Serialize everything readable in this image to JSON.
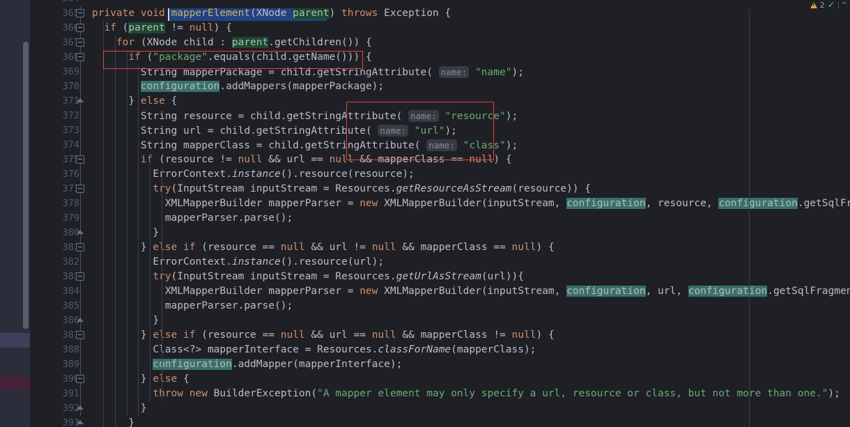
{
  "editor": {
    "language": "java",
    "theme_background": "#1e2025",
    "gutter_background": "#1e2025",
    "annotation_strip_background": "#2b2d3a",
    "selection_color": "#214283",
    "usage_highlight_color": "#1b4a2c",
    "identifier_highlight_color": "#3a7068",
    "annotation_box_color": "#e8453c",
    "first_visible_line": 364,
    "last_visible_line": 393
  },
  "status": {
    "warning_icon": "warning-triangle-icon",
    "warning_count": "2",
    "inspection_icon": "green-check-icon",
    "collapse_icon": "chevron-up-icon"
  },
  "line_numbers": [
    "364",
    "365",
    "366",
    "367",
    "368",
    "369",
    "370",
    "371",
    "372",
    "373",
    "374",
    "375",
    "376",
    "377",
    "378",
    "379",
    "380",
    "381",
    "382",
    "383",
    "384",
    "385",
    "386",
    "387",
    "388",
    "389",
    "390",
    "391",
    "392",
    "393"
  ],
  "code_lines": [
    {
      "n": "364",
      "text": ""
    },
    {
      "n": "365",
      "text": "private void mapperElement(XNode parent) throws Exception {"
    },
    {
      "n": "366",
      "text": "  if (parent != null) {"
    },
    {
      "n": "367",
      "text": "    for (XNode child : parent.getChildren()) {"
    },
    {
      "n": "368",
      "text": "      if (\"package\".equals(child.getName())) {"
    },
    {
      "n": "369",
      "text": "        String mapperPackage = child.getStringAttribute( name: \"name\");"
    },
    {
      "n": "370",
      "text": "        configuration.addMappers(mapperPackage);"
    },
    {
      "n": "371",
      "text": "      } else {"
    },
    {
      "n": "372",
      "text": "        String resource = child.getStringAttribute( name: \"resource\");"
    },
    {
      "n": "373",
      "text": "        String url = child.getStringAttribute( name: \"url\");"
    },
    {
      "n": "374",
      "text": "        String mapperClass = child.getStringAttribute( name: \"class\");"
    },
    {
      "n": "375",
      "text": "        if (resource != null && url == null && mapperClass == null) {"
    },
    {
      "n": "376",
      "text": "          ErrorContext.instance().resource(resource);"
    },
    {
      "n": "377",
      "text": "          try(InputStream inputStream = Resources.getResourceAsStream(resource)) {"
    },
    {
      "n": "378",
      "text": "            XMLMapperBuilder mapperParser = new XMLMapperBuilder(inputStream, configuration, resource, configuration.getSqlFragments());"
    },
    {
      "n": "379",
      "text": "            mapperParser.parse();"
    },
    {
      "n": "380",
      "text": "          }"
    },
    {
      "n": "381",
      "text": "        } else if (resource == null && url != null && mapperClass == null) {"
    },
    {
      "n": "382",
      "text": "          ErrorContext.instance().resource(url);"
    },
    {
      "n": "383",
      "text": "          try(InputStream inputStream = Resources.getUrlAsStream(url)){"
    },
    {
      "n": "384",
      "text": "            XMLMapperBuilder mapperParser = new XMLMapperBuilder(inputStream, configuration, url, configuration.getSqlFragments());"
    },
    {
      "n": "385",
      "text": "            mapperParser.parse();"
    },
    {
      "n": "386",
      "text": "          }"
    },
    {
      "n": "387",
      "text": "        } else if (resource == null && url == null && mapperClass != null) {"
    },
    {
      "n": "388",
      "text": "          Class<?> mapperInterface = Resources.classForName(mapperClass);"
    },
    {
      "n": "389",
      "text": "          configuration.addMapper(mapperInterface);"
    },
    {
      "n": "390",
      "text": "        } else {"
    },
    {
      "n": "391",
      "text": "          throw new BuilderException(\"A mapper element may only specify a url, resource or class, but not more than one.\");"
    },
    {
      "n": "392",
      "text": "        }"
    },
    {
      "n": "393",
      "text": "      }"
    }
  ],
  "parameter_hints": [
    {
      "line": "369",
      "label": "name:"
    },
    {
      "line": "372",
      "label": "name:"
    },
    {
      "line": "373",
      "label": "name:"
    },
    {
      "line": "374",
      "label": "name:"
    }
  ],
  "annotations": [
    {
      "id": "box-package-check",
      "target_line": "368"
    },
    {
      "id": "box-attribute-reads",
      "target_lines": "372-374"
    }
  ],
  "tokens": {
    "selected_text": "mapperElement(XNode parent)",
    "highlighted_identifier": "configuration",
    "usage_highlight": "parent"
  }
}
